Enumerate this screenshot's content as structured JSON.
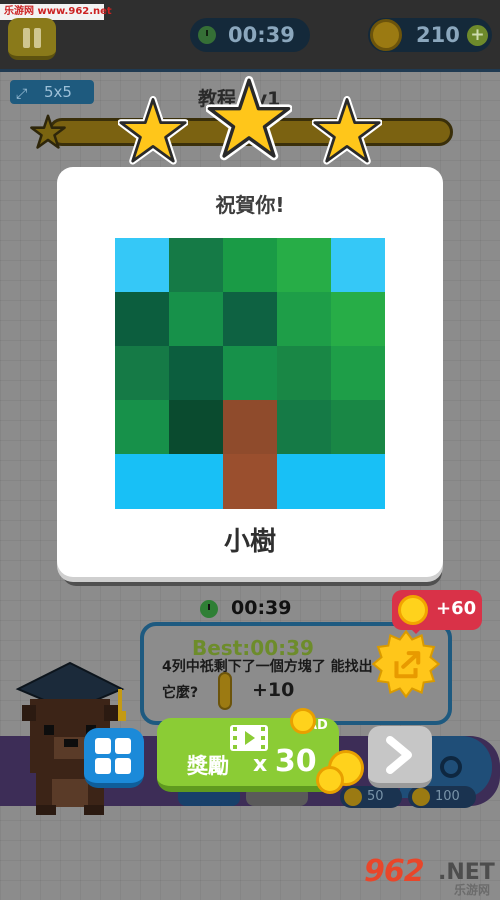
{
  "watermark_top": "乐游网 www.962.net",
  "top_bar": {
    "timer": "00:39",
    "coins": "210"
  },
  "level": {
    "grid_size": "5x5",
    "title": "教程 Lv1"
  },
  "dialog": {
    "title": "祝賀你!",
    "result_name": "小樹",
    "pixel_art": [
      [
        "#35c8f7",
        "#157a46",
        "#1a9b46",
        "#27ad47",
        "#35c8f7"
      ],
      [
        "#0c5e3e",
        "#17914a",
        "#0e6242",
        "#1e9e48",
        "#27ad47"
      ],
      [
        "#157a46",
        "#0c5e3e",
        "#17914a",
        "#198745",
        "#1e9e48"
      ],
      [
        "#17914a",
        "#0a4b2f",
        "#8f4b2c",
        "#157a46",
        "#198745"
      ],
      [
        "#18c0f6",
        "#18c0f6",
        "#9a4f2e",
        "#18c0f6",
        "#18c0f6"
      ]
    ]
  },
  "hint": {
    "timer": "00:39",
    "best_score": "Best:00:39",
    "text": "4列中祇剩下了一個方塊了 能找出它麼?",
    "coin_reward": "+10"
  },
  "share": {
    "reward": "+60"
  },
  "reward_button": {
    "label": "獎勵",
    "multiplier": "30",
    "ad_label": "AD"
  },
  "costs": {
    "cost_a": "50",
    "cost_b": "100"
  },
  "watermark_bottom": {
    "brand": "962",
    "suffix": ".NET",
    "cn": "乐游网"
  }
}
